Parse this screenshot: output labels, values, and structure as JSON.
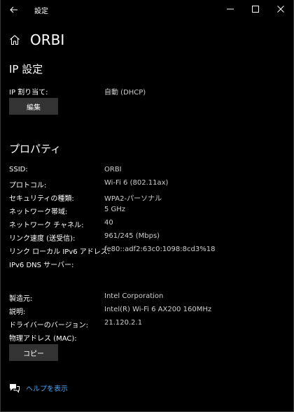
{
  "window": {
    "title": "設定",
    "back_icon": "back-arrow-icon",
    "minimize_icon": "minimize-icon",
    "maximize_icon": "maximize-icon",
    "close_icon": "close-icon"
  },
  "header": {
    "home_icon": "home-icon",
    "title": "ORBI"
  },
  "ip_section": {
    "title": "IP 設定",
    "assignment_label": "IP 割り当て:",
    "assignment_value": "自動 (DHCP)",
    "edit_button": "編集"
  },
  "properties": {
    "title": "プロパティ",
    "rows": [
      {
        "label": "SSID:",
        "value": "ORBI"
      },
      {
        "label": "プロトコル:",
        "value": "Wi-Fi 6 (802.11ax)"
      },
      {
        "label": "セキュリティの種類:",
        "value": "WPA2-パーソナル"
      },
      {
        "label": "ネットワーク帯域:",
        "value": "5 GHz"
      },
      {
        "label": "ネットワーク チャネル:",
        "value": "40"
      },
      {
        "label": "リンク速度 (送受信):",
        "value": "961/245 (Mbps)"
      },
      {
        "label": "リンク ローカル IPv6 アドレス:",
        "value": "fe80::adf2:63c0:1098:8cd3%18"
      },
      {
        "label": "IPv6 DNS サーバー:",
        "value": ""
      }
    ],
    "hardware_rows": [
      {
        "label": "製造元:",
        "value": "Intel Corporation"
      },
      {
        "label": "説明:",
        "value": "Intel(R) Wi-Fi 6 AX200 160MHz"
      },
      {
        "label": "ドライバーのバージョン:",
        "value": "21.120.2.1"
      },
      {
        "label": "物理アドレス (MAC):",
        "value": ""
      }
    ],
    "copy_button": "コピー"
  },
  "help": {
    "icon": "help-chat-icon",
    "link": "ヘルプを表示"
  },
  "colors": {
    "background": "#000000",
    "button": "#333333",
    "link": "#4aa3f0",
    "value_text": "#cfcfcf"
  }
}
